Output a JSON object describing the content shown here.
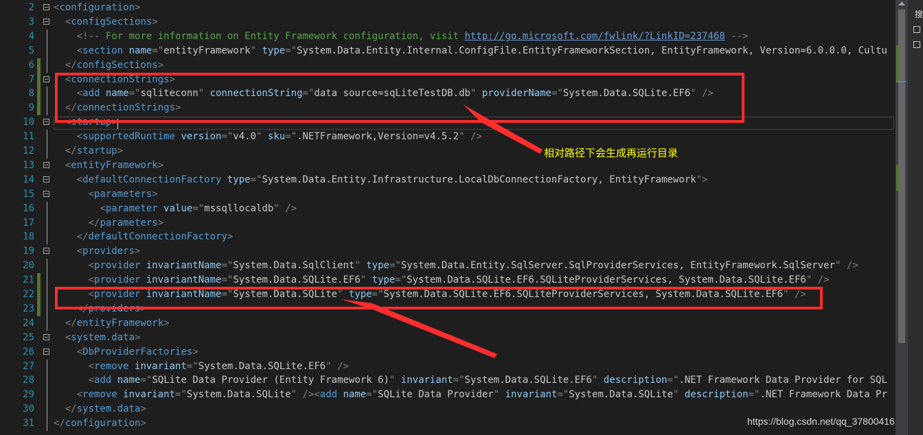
{
  "editor": {
    "lines": [
      {
        "num": "2",
        "parts": [
          [
            "b",
            "<"
          ],
          [
            "t",
            "configuration"
          ],
          [
            "b",
            ">"
          ]
        ]
      },
      {
        "num": "3",
        "parts": [
          [
            "v",
            "  "
          ],
          [
            "b",
            "<"
          ],
          [
            "t",
            "configSections"
          ],
          [
            "b",
            ">"
          ]
        ]
      },
      {
        "num": "4",
        "parts": [
          [
            "v",
            "    "
          ],
          [
            "b",
            "<!--"
          ],
          [
            "c",
            " For more information on Entity Framework configuration, visit "
          ],
          [
            "u",
            "http://go.microsoft.com/fwlink/?LinkID=237468"
          ],
          [
            "c",
            " "
          ],
          [
            "b",
            "-->"
          ]
        ]
      },
      {
        "num": "5",
        "parts": [
          [
            "v",
            "    "
          ],
          [
            "b",
            "<"
          ],
          [
            "t",
            "section"
          ],
          [
            "a",
            " name"
          ],
          [
            "b",
            "="
          ],
          [
            "b",
            "\""
          ],
          [
            "v",
            "entityFramework"
          ],
          [
            "b",
            "\""
          ],
          [
            "a",
            " type"
          ],
          [
            "b",
            "="
          ],
          [
            "b",
            "\""
          ],
          [
            "v",
            "System.Data.Entity.Internal.ConfigFile.EntityFrameworkSection, EntityFramework, Version=6.0.0.0, Cultu"
          ]
        ]
      },
      {
        "num": "6",
        "parts": [
          [
            "v",
            "  "
          ],
          [
            "b",
            "</"
          ],
          [
            "t",
            "configSections"
          ],
          [
            "b",
            ">"
          ]
        ]
      },
      {
        "num": "7",
        "parts": [
          [
            "v",
            "  "
          ],
          [
            "b",
            "<"
          ],
          [
            "t",
            "connectionStrings"
          ],
          [
            "b",
            ">"
          ]
        ]
      },
      {
        "num": "8",
        "parts": [
          [
            "v",
            "    "
          ],
          [
            "b",
            "<"
          ],
          [
            "t",
            "add"
          ],
          [
            "a",
            " name"
          ],
          [
            "b",
            "="
          ],
          [
            "b",
            "\""
          ],
          [
            "v",
            "sqliteconn"
          ],
          [
            "b",
            "\""
          ],
          [
            "a",
            " connectionString"
          ],
          [
            "b",
            "="
          ],
          [
            "b",
            "\""
          ],
          [
            "v",
            "data source=sqLiteTestDB.db"
          ],
          [
            "b",
            "\""
          ],
          [
            "a",
            " providerName"
          ],
          [
            "b",
            "="
          ],
          [
            "b",
            "\""
          ],
          [
            "v",
            "System.Data.SQLite.EF6"
          ],
          [
            "b",
            "\""
          ],
          [
            "b",
            " />"
          ]
        ]
      },
      {
        "num": "9",
        "parts": [
          [
            "v",
            "  "
          ],
          [
            "b",
            "</"
          ],
          [
            "t",
            "connectionStrings"
          ],
          [
            "b",
            ">"
          ]
        ]
      },
      {
        "num": "10",
        "parts": [
          [
            "v",
            "  "
          ],
          [
            "b",
            "<"
          ],
          [
            "t",
            "startup"
          ],
          [
            "b",
            ">"
          ]
        ]
      },
      {
        "num": "11",
        "parts": [
          [
            "v",
            "    "
          ],
          [
            "b",
            "<"
          ],
          [
            "t",
            "supportedRuntime"
          ],
          [
            "a",
            " version"
          ],
          [
            "b",
            "="
          ],
          [
            "b",
            "\""
          ],
          [
            "v",
            "v4.0"
          ],
          [
            "b",
            "\""
          ],
          [
            "a",
            " sku"
          ],
          [
            "b",
            "="
          ],
          [
            "b",
            "\""
          ],
          [
            "v",
            ".NETFramework,Version=v4.5.2"
          ],
          [
            "b",
            "\""
          ],
          [
            "b",
            " />"
          ]
        ]
      },
      {
        "num": "12",
        "parts": [
          [
            "v",
            "  "
          ],
          [
            "b",
            "</"
          ],
          [
            "t",
            "startup"
          ],
          [
            "b",
            ">"
          ]
        ]
      },
      {
        "num": "13",
        "parts": [
          [
            "v",
            "  "
          ],
          [
            "b",
            "<"
          ],
          [
            "t",
            "entityFramework"
          ],
          [
            "b",
            ">"
          ]
        ]
      },
      {
        "num": "14",
        "parts": [
          [
            "v",
            "    "
          ],
          [
            "b",
            "<"
          ],
          [
            "t",
            "defaultConnectionFactory"
          ],
          [
            "a",
            " type"
          ],
          [
            "b",
            "="
          ],
          [
            "b",
            "\""
          ],
          [
            "v",
            "System.Data.Entity.Infrastructure.LocalDbConnectionFactory, EntityFramework"
          ],
          [
            "b",
            "\""
          ],
          [
            "b",
            ">"
          ]
        ]
      },
      {
        "num": "15",
        "parts": [
          [
            "v",
            "      "
          ],
          [
            "b",
            "<"
          ],
          [
            "t",
            "parameters"
          ],
          [
            "b",
            ">"
          ]
        ]
      },
      {
        "num": "16",
        "parts": [
          [
            "v",
            "        "
          ],
          [
            "b",
            "<"
          ],
          [
            "t",
            "parameter"
          ],
          [
            "a",
            " value"
          ],
          [
            "b",
            "="
          ],
          [
            "b",
            "\""
          ],
          [
            "v",
            "mssqllocaldb"
          ],
          [
            "b",
            "\""
          ],
          [
            "b",
            " />"
          ]
        ]
      },
      {
        "num": "17",
        "parts": [
          [
            "v",
            "      "
          ],
          [
            "b",
            "</"
          ],
          [
            "t",
            "parameters"
          ],
          [
            "b",
            ">"
          ]
        ]
      },
      {
        "num": "18",
        "parts": [
          [
            "v",
            "    "
          ],
          [
            "b",
            "</"
          ],
          [
            "t",
            "defaultConnectionFactory"
          ],
          [
            "b",
            ">"
          ]
        ]
      },
      {
        "num": "19",
        "parts": [
          [
            "v",
            "    "
          ],
          [
            "b",
            "<"
          ],
          [
            "t",
            "providers"
          ],
          [
            "b",
            ">"
          ]
        ]
      },
      {
        "num": "20",
        "parts": [
          [
            "v",
            "      "
          ],
          [
            "b",
            "<"
          ],
          [
            "t",
            "provider"
          ],
          [
            "a",
            " invariantName"
          ],
          [
            "b",
            "="
          ],
          [
            "b",
            "\""
          ],
          [
            "v",
            "System.Data.SqlClient"
          ],
          [
            "b",
            "\""
          ],
          [
            "a",
            " type"
          ],
          [
            "b",
            "="
          ],
          [
            "b",
            "\""
          ],
          [
            "v",
            "System.Data.Entity.SqlServer.SqlProviderServices, EntityFramework.SqlServer"
          ],
          [
            "b",
            "\""
          ],
          [
            "b",
            " />"
          ]
        ]
      },
      {
        "num": "21",
        "parts": [
          [
            "v",
            "      "
          ],
          [
            "b",
            "<"
          ],
          [
            "t",
            "provider"
          ],
          [
            "a",
            " invariantName"
          ],
          [
            "b",
            "="
          ],
          [
            "b",
            "\""
          ],
          [
            "v",
            "System.Data.SQLite.EF6"
          ],
          [
            "b",
            "\""
          ],
          [
            "a",
            " type"
          ],
          [
            "b",
            "="
          ],
          [
            "b",
            "\""
          ],
          [
            "v",
            "System.Data.SQLite.EF6.SQLiteProviderServices, System.Data.SQLite.EF6"
          ],
          [
            "b",
            "\""
          ],
          [
            "b",
            " />"
          ]
        ]
      },
      {
        "num": "22",
        "parts": [
          [
            "v",
            "      "
          ],
          [
            "b",
            "<"
          ],
          [
            "t",
            "provider"
          ],
          [
            "a",
            " invariantName"
          ],
          [
            "b",
            "="
          ],
          [
            "b",
            "\""
          ],
          [
            "v",
            "System.Data.SQLite"
          ],
          [
            "b",
            "\""
          ],
          [
            "a",
            " type"
          ],
          [
            "b",
            "="
          ],
          [
            "b",
            "\""
          ],
          [
            "v",
            "System.Data.SQLite.EF6.SQLiteProviderServices, System.Data.SQLite.EF6"
          ],
          [
            "b",
            "\""
          ],
          [
            "b",
            " />"
          ]
        ]
      },
      {
        "num": "23",
        "parts": [
          [
            "v",
            "    "
          ],
          [
            "b",
            "</"
          ],
          [
            "t",
            "providers"
          ],
          [
            "b",
            ">"
          ]
        ]
      },
      {
        "num": "24",
        "parts": [
          [
            "v",
            "  "
          ],
          [
            "b",
            "</"
          ],
          [
            "t",
            "entityFramework"
          ],
          [
            "b",
            ">"
          ]
        ]
      },
      {
        "num": "25",
        "parts": [
          [
            "v",
            "  "
          ],
          [
            "b",
            "<"
          ],
          [
            "t",
            "system.data"
          ],
          [
            "b",
            ">"
          ]
        ]
      },
      {
        "num": "26",
        "parts": [
          [
            "v",
            "    "
          ],
          [
            "b",
            "<"
          ],
          [
            "t",
            "DbProviderFactories"
          ],
          [
            "b",
            ">"
          ]
        ]
      },
      {
        "num": "27",
        "parts": [
          [
            "v",
            "      "
          ],
          [
            "b",
            "<"
          ],
          [
            "t",
            "remove"
          ],
          [
            "a",
            " invariant"
          ],
          [
            "b",
            "="
          ],
          [
            "b",
            "\""
          ],
          [
            "v",
            "System.Data.SQLite.EF6"
          ],
          [
            "b",
            "\""
          ],
          [
            "b",
            " />"
          ]
        ]
      },
      {
        "num": "28",
        "parts": [
          [
            "v",
            "      "
          ],
          [
            "b",
            "<"
          ],
          [
            "t",
            "add"
          ],
          [
            "a",
            " name"
          ],
          [
            "b",
            "="
          ],
          [
            "b",
            "\""
          ],
          [
            "v",
            "SQLite Data Provider (Entity Framework 6)"
          ],
          [
            "b",
            "\""
          ],
          [
            "a",
            " invariant"
          ],
          [
            "b",
            "="
          ],
          [
            "b",
            "\""
          ],
          [
            "v",
            "System.Data.SQLite.EF6"
          ],
          [
            "b",
            "\""
          ],
          [
            "a",
            " description"
          ],
          [
            "b",
            "="
          ],
          [
            "b",
            "\""
          ],
          [
            "v",
            ".NET Framework Data Provider for SQL"
          ]
        ]
      },
      {
        "num": "29",
        "parts": [
          [
            "v",
            "    "
          ],
          [
            "b",
            "<"
          ],
          [
            "t",
            "remove"
          ],
          [
            "a",
            " invariant"
          ],
          [
            "b",
            "="
          ],
          [
            "b",
            "\""
          ],
          [
            "v",
            "System.Data.SQLite"
          ],
          [
            "b",
            "\""
          ],
          [
            "b",
            " /><"
          ],
          [
            "t",
            "add"
          ],
          [
            "a",
            " name"
          ],
          [
            "b",
            "="
          ],
          [
            "b",
            "\""
          ],
          [
            "v",
            "SQLite Data Provider"
          ],
          [
            "b",
            "\""
          ],
          [
            "a",
            " invariant"
          ],
          [
            "b",
            "="
          ],
          [
            "b",
            "\""
          ],
          [
            "v",
            "System.Data.SQLite"
          ],
          [
            "b",
            "\""
          ],
          [
            "a",
            " description"
          ],
          [
            "b",
            "="
          ],
          [
            "b",
            "\""
          ],
          [
            "v",
            ".NET Framework Data Pr"
          ]
        ]
      },
      {
        "num": "30",
        "parts": [
          [
            "v",
            "  "
          ],
          [
            "b",
            "</"
          ],
          [
            "t",
            "system.data"
          ],
          [
            "b",
            ">"
          ]
        ]
      },
      {
        "num": "31",
        "parts": [
          [
            "b",
            "</"
          ],
          [
            "t",
            "configuration"
          ],
          [
            "b",
            ">"
          ]
        ]
      }
    ]
  },
  "annotation": {
    "text": "相对路径下会生成再运行目录"
  },
  "right_panel": {
    "label": "搜"
  },
  "watermark": {
    "text": "https://blog.csdn.net/qq_37800416"
  },
  "colors": {
    "highlight": "#ff2d2d",
    "annotation": "#ffff00"
  }
}
